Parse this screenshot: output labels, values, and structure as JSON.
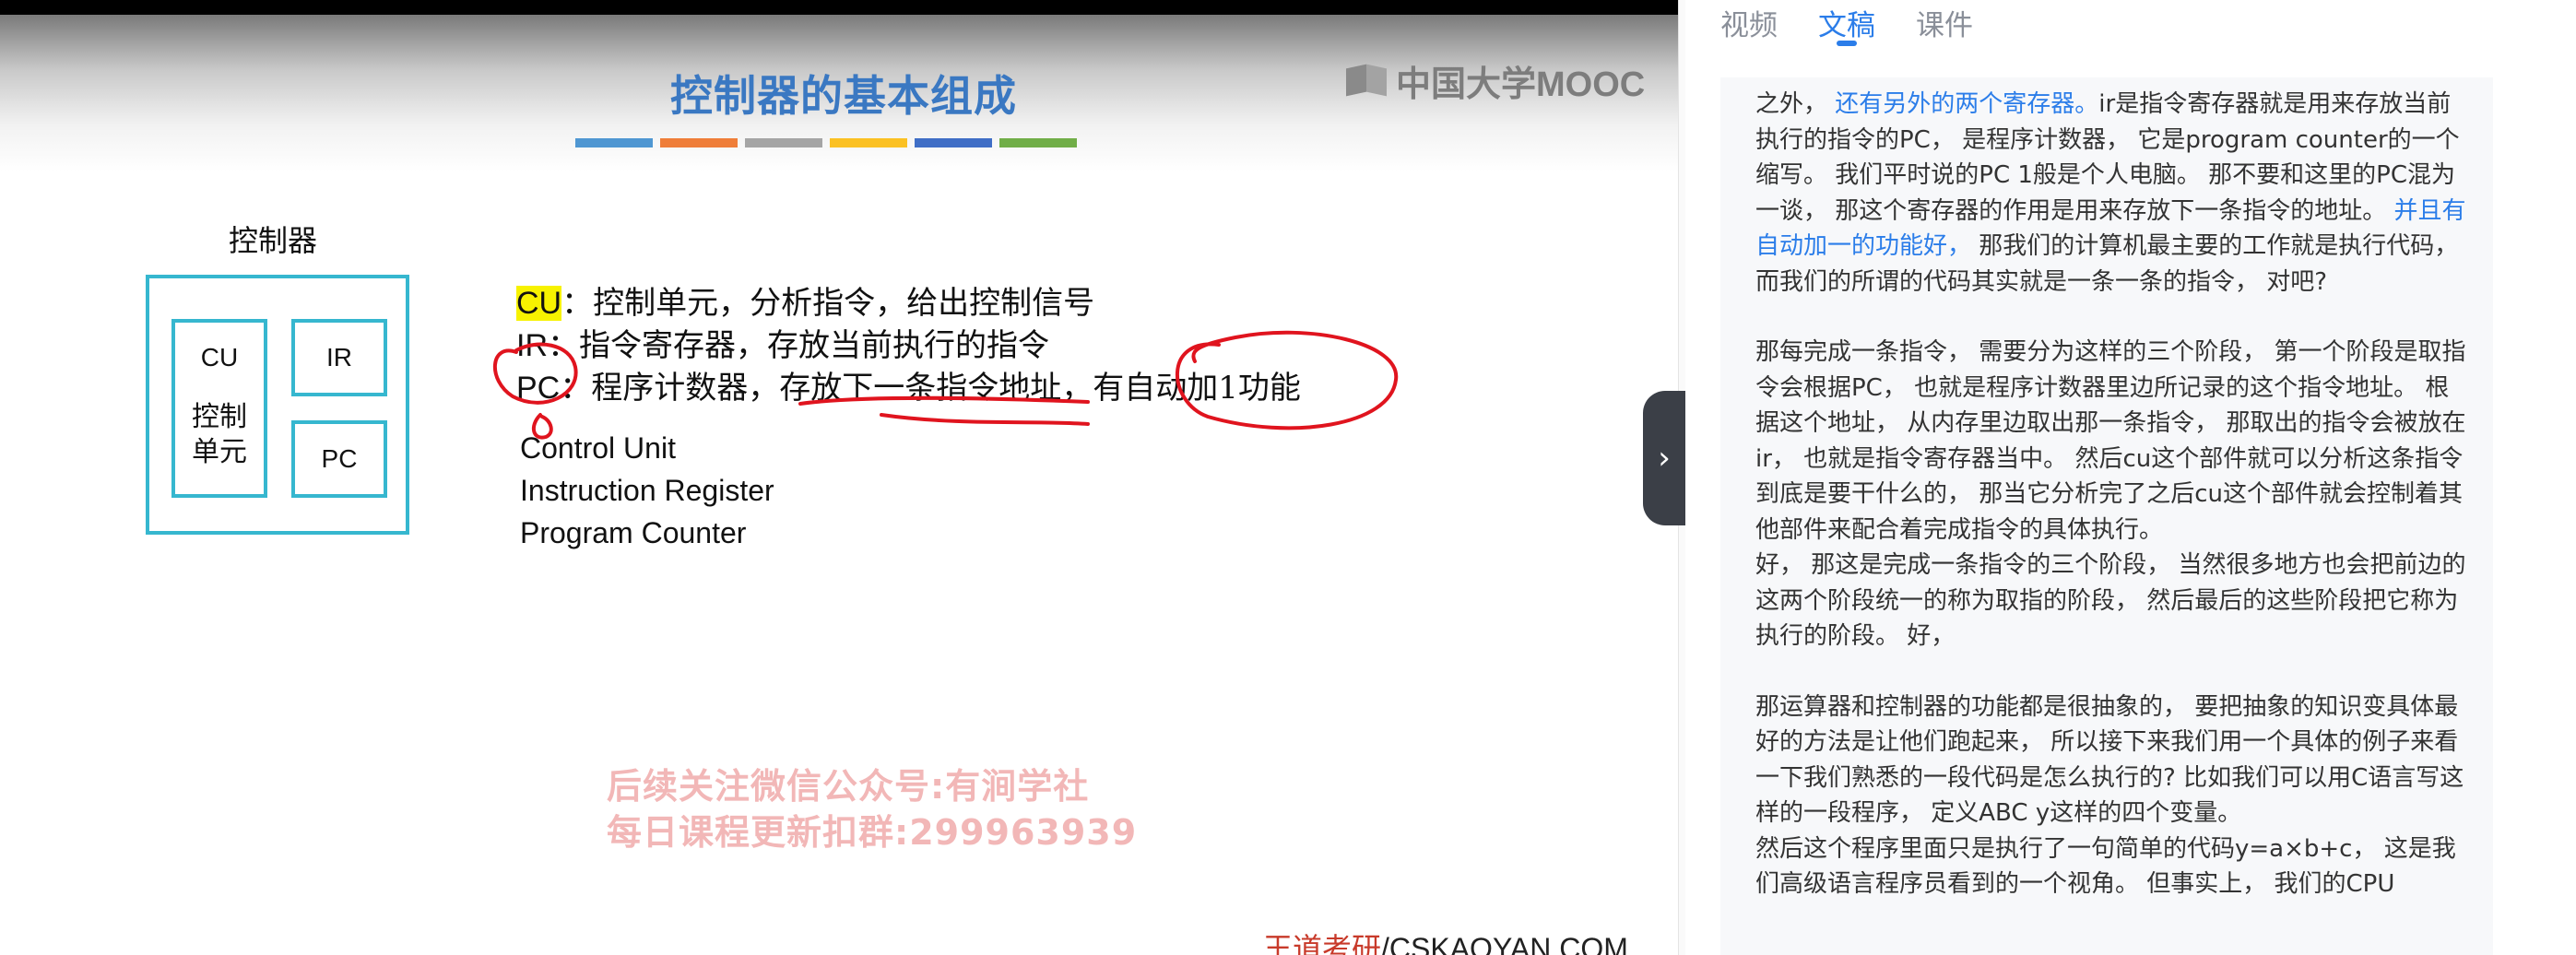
{
  "slide": {
    "title": "控制器的基本组成",
    "mooc_logo_text": "中国大学MOOC",
    "color_bar": [
      "#4f97d2",
      "#ef7e39",
      "#a5a5a5",
      "#fbc123",
      "#3f6ec6",
      "#71ae48"
    ],
    "controller_label": "控制器",
    "boxes": {
      "cu_title": "CU",
      "cu_cn_1": "控制",
      "cu_cn_2": "单元",
      "ir": "IR",
      "pc": "PC"
    },
    "definitions": [
      {
        "abbr": "CU",
        "colon": "：",
        "text": "控制单元，分析指令，给出控制信号"
      },
      {
        "abbr": "IR",
        "colon": "：",
        "text": "指令寄存器，存放当前执行的指令"
      },
      {
        "abbr": "PC",
        "colon": "：",
        "text_1": "程序计数器，",
        "text_2": "存放下一条指令地址",
        "text_3": "，有",
        "text_4": "自动加1功能"
      }
    ],
    "english": [
      "Control Unit",
      "Instruction Register",
      "Program Counter"
    ],
    "watermark": [
      "后续关注微信公众号:有涧学社",
      "每日课程更新扣群:299963939"
    ],
    "footer_cn": "王道考研",
    "footer_en": "/CSKAOYAN.COM"
  },
  "expand_icon": "chevron-right",
  "panel": {
    "tabs": [
      {
        "label": "视频",
        "active": false
      },
      {
        "label": "文稿",
        "active": true
      },
      {
        "label": "课件",
        "active": false
      }
    ],
    "paragraphs": [
      {
        "a": "之外， ",
        "link1": "还有另外的两个寄存器。",
        "b": "ir是指令寄存器就是用来存放当前执行的指令的PC， 是程序计数器， 它是program counter的一个缩写。 我们平时说的PC 1般是个人电脑。 那不要和这里的PC混为一谈， 那这个寄存器的作用是用来存放下一条指令的地址。 ",
        "link2": "并且有自动加一的功能好，",
        "c": " 那我们的计算机最主要的工作就是执行代码， 而我们的所谓的代码其实就是一条一条的指令， 对吧?"
      },
      {
        "text": "那每完成一条指令， 需要分为这样的三个阶段， 第一个阶段是取指令会根据PC， 也就是程序计数器里边所记录的这个指令地址。 根据这个地址， 从内存里边取出那一条指令， 那取出的指令会被放在ir， 也就是指令寄存器当中。 然后cu这个部件就可以分析这条指令到底是要干什么的， 那当它分析完了之后cu这个部件就会控制着其他部件来配合着完成指令的具体执行。",
        "text2": " 好， 那这是完成一条指令的三个阶段， 当然很多地方也会把前边的这两个阶段统一的称为取指的阶段， 然后最后的这些阶段把它称为执行的阶段。 好，"
      },
      {
        "text": "那运算器和控制器的功能都是很抽象的， 要把抽象的知识变具体最好的方法是让他们跑起来， 所以接下来我们用一个具体的例子来看一下我们熟悉的一段代码是怎么执行的? 比如我们可以用C语言写这样的一段程序， 定义ABC y这样的四个变量。",
        "text2": " 然后这个程序里面只是执行了一句简单的代码y=a×b+c， 这是我们高级语言程序员看到的一个视角。 但事实上， 我们的CPU"
      }
    ]
  }
}
